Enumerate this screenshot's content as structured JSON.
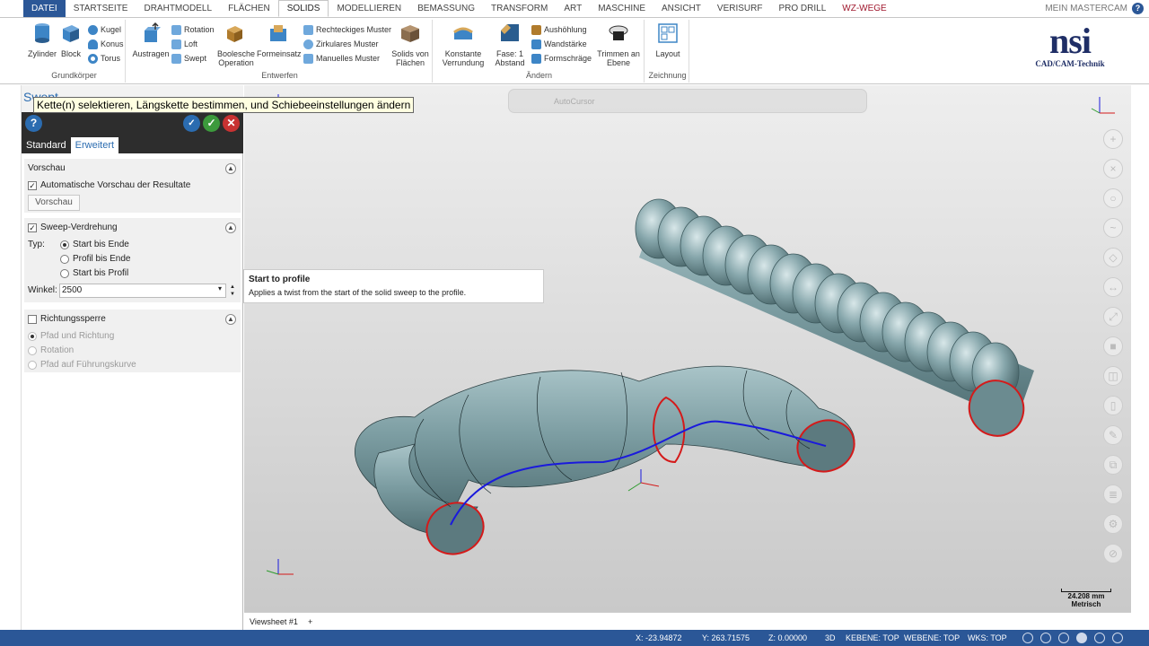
{
  "ribbon_tabs": [
    {
      "label": "DATEI"
    },
    {
      "label": "STARTSEITE"
    },
    {
      "label": "DRAHTMODELL"
    },
    {
      "label": "FLÄCHEN"
    },
    {
      "label": "SOLIDS"
    },
    {
      "label": "MODELLIEREN"
    },
    {
      "label": "BEMASSUNG"
    },
    {
      "label": "TRANSFORM"
    },
    {
      "label": "ART"
    },
    {
      "label": "MASCHINE"
    },
    {
      "label": "ANSICHT"
    },
    {
      "label": "VERISURF"
    },
    {
      "label": "PRO DRILL"
    },
    {
      "label": "WZ-WEGE"
    }
  ],
  "account": "MEIN MASTERCAM",
  "groups": {
    "grundkoerper": {
      "label": "Grundkörper",
      "zylinder": "Zylinder",
      "block": "Block",
      "kugel": "Kugel",
      "konus": "Konus",
      "torus": "Torus"
    },
    "entwerfen": {
      "label": "Entwerfen",
      "austragen": "Austragen",
      "rotation": "Rotation",
      "loft": "Loft",
      "swept": "Swept",
      "boolesche": "Boolesche Operation",
      "formeinsatz": "Formeinsatz",
      "rechteckiges": "Rechteckiges Muster",
      "zirkulares": "Zirkulares Muster",
      "manuelles": "Manuelles Muster",
      "solids_von_flaechen": "Solids von Flächen"
    },
    "aendern": {
      "label": "Ändern",
      "konstante": "Konstante Verrundung",
      "fase": "Fase: 1 Abstand",
      "aushoehlung": "Aushöhlung",
      "wandstaerke": "Wandstärke",
      "formschraege": "Formschräge",
      "trimmen": "Trimmen an Ebene"
    },
    "zeichnung": {
      "label": "Zeichnung",
      "layout": "Layout"
    }
  },
  "logo": {
    "main": "nsi",
    "sub": "CAD/CAM-Technik"
  },
  "panel": {
    "title": "Swept",
    "tabs": [
      "Standard",
      "Erweitert"
    ],
    "vorschau": {
      "title": "Vorschau",
      "auto": "Automatische Vorschau der Resultate",
      "button": "Vorschau"
    },
    "sweep": {
      "title": "Sweep-Verdrehung",
      "typ_label": "Typ:",
      "options": [
        "Start bis Ende",
        "Profil bis Ende",
        "Start bis Profil"
      ],
      "selected": 0,
      "winkel_label": "Winkel:",
      "winkel_value": "2500"
    },
    "richtung": {
      "title": "Richtungssperre",
      "options": [
        "Pfad und Richtung",
        "Rotation",
        "Pfad auf Führungskurve"
      ]
    }
  },
  "prompt": "Kette(n) selektieren, Längskette bestimmen, und Schiebeeinstellungen ändern",
  "tooltip": {
    "title": "Start to profile",
    "desc": "Applies a twist from the start of the solid sweep to the profile."
  },
  "floating_toolbar": "AutoCursor",
  "viewsheet": "Viewsheet #1",
  "scale": {
    "value": "24.208 mm",
    "unit": "Metrisch"
  },
  "status": {
    "x": "X:   -23.94872",
    "y": "Y:   263.71575",
    "z": "Z:   0.00000",
    "mode": "3D",
    "kebene": "KEBENE: TOP",
    "webene": "WEBENE: TOP",
    "wks": "WKS: TOP"
  },
  "colors": {
    "accent": "#2b5797",
    "solid": "#7d9ea3",
    "path": "#1a1adc",
    "profile": "#d41a1a"
  }
}
